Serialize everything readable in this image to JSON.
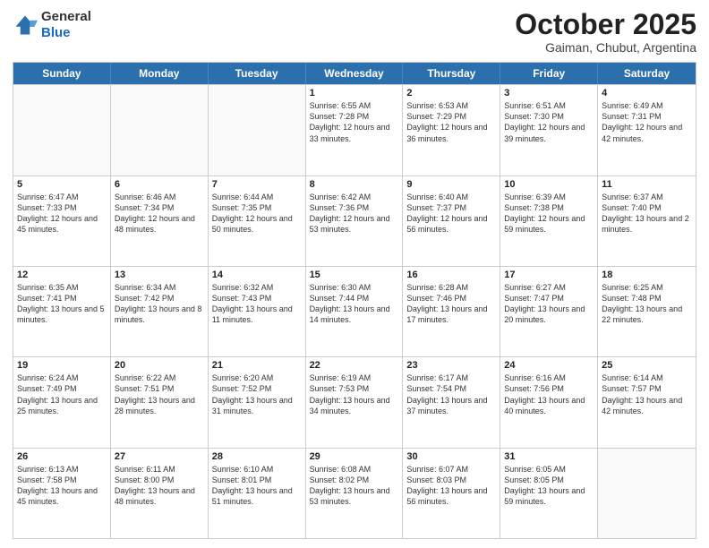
{
  "header": {
    "logo": {
      "general": "General",
      "blue": "Blue"
    },
    "month": "October 2025",
    "location": "Gaiman, Chubut, Argentina"
  },
  "weekdays": [
    "Sunday",
    "Monday",
    "Tuesday",
    "Wednesday",
    "Thursday",
    "Friday",
    "Saturday"
  ],
  "rows": [
    [
      {
        "day": "",
        "text": ""
      },
      {
        "day": "",
        "text": ""
      },
      {
        "day": "",
        "text": ""
      },
      {
        "day": "1",
        "text": "Sunrise: 6:55 AM\nSunset: 7:28 PM\nDaylight: 12 hours and 33 minutes."
      },
      {
        "day": "2",
        "text": "Sunrise: 6:53 AM\nSunset: 7:29 PM\nDaylight: 12 hours and 36 minutes."
      },
      {
        "day": "3",
        "text": "Sunrise: 6:51 AM\nSunset: 7:30 PM\nDaylight: 12 hours and 39 minutes."
      },
      {
        "day": "4",
        "text": "Sunrise: 6:49 AM\nSunset: 7:31 PM\nDaylight: 12 hours and 42 minutes."
      }
    ],
    [
      {
        "day": "5",
        "text": "Sunrise: 6:47 AM\nSunset: 7:33 PM\nDaylight: 12 hours and 45 minutes."
      },
      {
        "day": "6",
        "text": "Sunrise: 6:46 AM\nSunset: 7:34 PM\nDaylight: 12 hours and 48 minutes."
      },
      {
        "day": "7",
        "text": "Sunrise: 6:44 AM\nSunset: 7:35 PM\nDaylight: 12 hours and 50 minutes."
      },
      {
        "day": "8",
        "text": "Sunrise: 6:42 AM\nSunset: 7:36 PM\nDaylight: 12 hours and 53 minutes."
      },
      {
        "day": "9",
        "text": "Sunrise: 6:40 AM\nSunset: 7:37 PM\nDaylight: 12 hours and 56 minutes."
      },
      {
        "day": "10",
        "text": "Sunrise: 6:39 AM\nSunset: 7:38 PM\nDaylight: 12 hours and 59 minutes."
      },
      {
        "day": "11",
        "text": "Sunrise: 6:37 AM\nSunset: 7:40 PM\nDaylight: 13 hours and 2 minutes."
      }
    ],
    [
      {
        "day": "12",
        "text": "Sunrise: 6:35 AM\nSunset: 7:41 PM\nDaylight: 13 hours and 5 minutes."
      },
      {
        "day": "13",
        "text": "Sunrise: 6:34 AM\nSunset: 7:42 PM\nDaylight: 13 hours and 8 minutes."
      },
      {
        "day": "14",
        "text": "Sunrise: 6:32 AM\nSunset: 7:43 PM\nDaylight: 13 hours and 11 minutes."
      },
      {
        "day": "15",
        "text": "Sunrise: 6:30 AM\nSunset: 7:44 PM\nDaylight: 13 hours and 14 minutes."
      },
      {
        "day": "16",
        "text": "Sunrise: 6:28 AM\nSunset: 7:46 PM\nDaylight: 13 hours and 17 minutes."
      },
      {
        "day": "17",
        "text": "Sunrise: 6:27 AM\nSunset: 7:47 PM\nDaylight: 13 hours and 20 minutes."
      },
      {
        "day": "18",
        "text": "Sunrise: 6:25 AM\nSunset: 7:48 PM\nDaylight: 13 hours and 22 minutes."
      }
    ],
    [
      {
        "day": "19",
        "text": "Sunrise: 6:24 AM\nSunset: 7:49 PM\nDaylight: 13 hours and 25 minutes."
      },
      {
        "day": "20",
        "text": "Sunrise: 6:22 AM\nSunset: 7:51 PM\nDaylight: 13 hours and 28 minutes."
      },
      {
        "day": "21",
        "text": "Sunrise: 6:20 AM\nSunset: 7:52 PM\nDaylight: 13 hours and 31 minutes."
      },
      {
        "day": "22",
        "text": "Sunrise: 6:19 AM\nSunset: 7:53 PM\nDaylight: 13 hours and 34 minutes."
      },
      {
        "day": "23",
        "text": "Sunrise: 6:17 AM\nSunset: 7:54 PM\nDaylight: 13 hours and 37 minutes."
      },
      {
        "day": "24",
        "text": "Sunrise: 6:16 AM\nSunset: 7:56 PM\nDaylight: 13 hours and 40 minutes."
      },
      {
        "day": "25",
        "text": "Sunrise: 6:14 AM\nSunset: 7:57 PM\nDaylight: 13 hours and 42 minutes."
      }
    ],
    [
      {
        "day": "26",
        "text": "Sunrise: 6:13 AM\nSunset: 7:58 PM\nDaylight: 13 hours and 45 minutes."
      },
      {
        "day": "27",
        "text": "Sunrise: 6:11 AM\nSunset: 8:00 PM\nDaylight: 13 hours and 48 minutes."
      },
      {
        "day": "28",
        "text": "Sunrise: 6:10 AM\nSunset: 8:01 PM\nDaylight: 13 hours and 51 minutes."
      },
      {
        "day": "29",
        "text": "Sunrise: 6:08 AM\nSunset: 8:02 PM\nDaylight: 13 hours and 53 minutes."
      },
      {
        "day": "30",
        "text": "Sunrise: 6:07 AM\nSunset: 8:03 PM\nDaylight: 13 hours and 56 minutes."
      },
      {
        "day": "31",
        "text": "Sunrise: 6:05 AM\nSunset: 8:05 PM\nDaylight: 13 hours and 59 minutes."
      },
      {
        "day": "",
        "text": ""
      }
    ]
  ]
}
